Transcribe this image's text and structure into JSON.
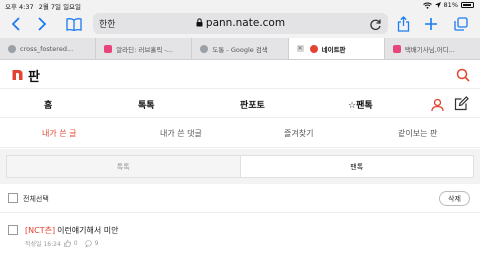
{
  "status_bar": {
    "time": "오후 4:37",
    "date": "2월 7일 일요일",
    "battery": "81%"
  },
  "toolbar": {
    "reader_label": "한한",
    "url": "pann.nate.com",
    "accent_color": "#1a7bf2"
  },
  "tabs": [
    {
      "label": "cross_fostered...",
      "favicon": "google-icon",
      "active": false,
      "color": "#9aa0a6"
    },
    {
      "label": "알라딘: 러브홀릭 -...",
      "favicon": "aladin-icon",
      "active": false,
      "color": "#e8467a"
    },
    {
      "label": "도통 - Google 검색",
      "favicon": "google-icon",
      "active": false,
      "color": "#9aa0a6"
    },
    {
      "label": "네이트판",
      "favicon": "nate-icon",
      "active": true,
      "color": "#e2442f"
    },
    {
      "label": "택배기사님,어디...",
      "favicon": "aladin-icon",
      "active": false,
      "color": "#e8467a"
    }
  ],
  "site": {
    "logo_text": "판",
    "brand_color": "#e2442f"
  },
  "main_nav": {
    "home": "홈",
    "talk": "톡톡",
    "pantoto": "판포토",
    "fantalk": "☆팬톡"
  },
  "sub_nav": {
    "my_posts": "내가 쓴 글",
    "my_comments": "내가 쓴 댓글",
    "favorites": "즐겨찾기",
    "shared": "같이보는 판"
  },
  "segment": {
    "talk": "톡톡",
    "fantalk": "팬톡"
  },
  "list": {
    "select_all": "전체선택",
    "delete": "삭제",
    "posts": [
      {
        "tag": "[NCT츤]",
        "title": "이런얘기해서 미안",
        "date_label": "작성일 16:24",
        "likes": "0",
        "comments": "9"
      }
    ]
  }
}
